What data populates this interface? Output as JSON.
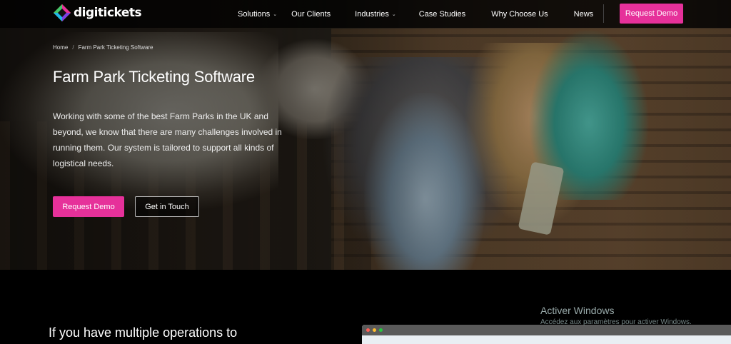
{
  "brand": {
    "name": "digitickets",
    "colors": {
      "accent": "#e6319a",
      "nav_bg": "#000000",
      "body_bg": "#000000"
    }
  },
  "nav": {
    "items": [
      {
        "label": "Solutions",
        "dropdown": true
      },
      {
        "label": "Our Clients",
        "dropdown": false
      },
      {
        "label": "Industries",
        "dropdown": true
      },
      {
        "label": "Case Studies",
        "dropdown": false
      },
      {
        "label": "Why Choose Us",
        "dropdown": false
      },
      {
        "label": "News",
        "dropdown": false
      }
    ],
    "cta_label": "Request Demo"
  },
  "breadcrumb": {
    "home": "Home",
    "separator": "/",
    "current": "Farm Park Ticketing Software"
  },
  "hero": {
    "title": "Farm Park Ticketing Software",
    "body": "Working with some of the best Farm Parks in the UK and beyond, we know that there are many challenges involved in running them. Our system is tailored to support all kinds of logistical needs.",
    "primary_button": "Request Demo",
    "secondary_button": "Get in Touch"
  },
  "section": {
    "heading": "If you have multiple operations to"
  },
  "windows_watermark": {
    "title": "Activer Windows",
    "subtitle": "Accédez aux paramètres pour activer Windows."
  },
  "icons": [
    "logo-icon",
    "chevron-down-icon"
  ]
}
